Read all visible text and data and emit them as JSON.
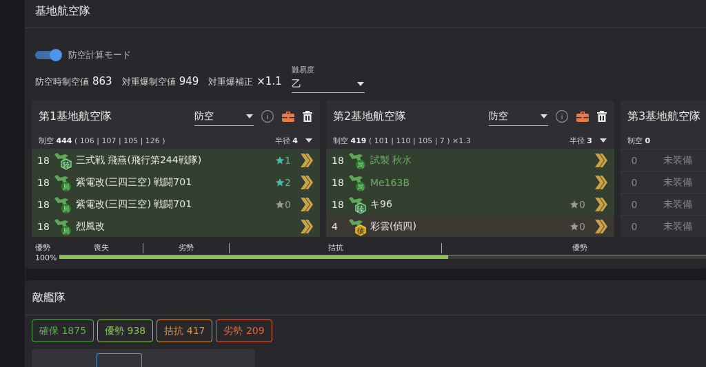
{
  "section_title": "基地航空隊",
  "mode_toggle": {
    "label": "防空計算モード",
    "on": true
  },
  "stats": [
    {
      "label": "防空時制空値",
      "value": "863"
    },
    {
      "label": "対重爆制空値",
      "value": "949"
    },
    {
      "label": "対重爆補正",
      "value": "×1.1"
    }
  ],
  "difficulty": {
    "label": "難易度",
    "value": "乙"
  },
  "bases": [
    {
      "title": "第1基地航空隊",
      "mode": "防空",
      "air_label": "制空",
      "air_value": "444",
      "air_detail": "( 106 | 107 | 105 | 126 )",
      "radius_label": "半径",
      "radius_value": "4",
      "slots": [
        {
          "count": "18",
          "kind": "army",
          "badge": "陸",
          "name": "三式戦 飛燕(飛行第244戦隊)",
          "color": "#e6e6e6",
          "stars": "1",
          "lit": true
        },
        {
          "count": "18",
          "kind": "local",
          "badge": "局",
          "name": "紫電改(三四三空) 戦闘701",
          "color": "#e6e6e6",
          "stars": "2",
          "lit": true
        },
        {
          "count": "18",
          "kind": "local",
          "badge": "局",
          "name": "紫電改(三四三空) 戦闘701",
          "color": "#e6e6e6",
          "stars": "0",
          "lit": false
        },
        {
          "count": "18",
          "kind": "local",
          "badge": "局",
          "name": "烈風改",
          "color": "#e6e6e6"
        }
      ]
    },
    {
      "title": "第2基地航空隊",
      "mode": "防空",
      "air_label": "制空",
      "air_value": "419",
      "air_detail": "( 101 | 110 | 105 | 7 ) ×1.3",
      "radius_label": "半径",
      "radius_value": "3",
      "slots": [
        {
          "count": "18",
          "kind": "local",
          "badge": "局",
          "name": "試製 秋水",
          "color": "#6fa866"
        },
        {
          "count": "18",
          "kind": "local",
          "badge": "局",
          "name": "Me163B",
          "color": "#6fa866"
        },
        {
          "count": "18",
          "kind": "army",
          "badge": "陸",
          "name": "キ96",
          "color": "#e6e6e6",
          "stars": "0",
          "lit": false
        },
        {
          "count": "4",
          "kind": "recon",
          "badge": "偵",
          "name": "彩雲(偵四)",
          "color": "#e6e6e6",
          "stars": "0",
          "lit": false
        }
      ]
    },
    {
      "title": "第3基地航空隊",
      "air_label": "制空",
      "air_value": "0",
      "slots": [
        {
          "count": "0",
          "kind": "empty",
          "name": "未装備"
        },
        {
          "count": "0",
          "kind": "empty",
          "name": "未装備"
        },
        {
          "count": "0",
          "kind": "empty",
          "name": "未装備"
        },
        {
          "count": "0",
          "kind": "empty",
          "name": "未装備"
        }
      ]
    }
  ],
  "air_state_bar": {
    "state": "優勢",
    "percent": "100%",
    "level": 0.59,
    "zones": [
      "喪失",
      "劣勢",
      "拮抗",
      "優勢"
    ]
  },
  "enemy_section": {
    "title": "敵艦隊",
    "thresholds": [
      {
        "label": "確保",
        "value": "1875",
        "color": "#5fae55"
      },
      {
        "label": "優勢",
        "value": "938",
        "color": "#8fc35a"
      },
      {
        "label": "拮抗",
        "value": "417",
        "color": "#e0913a"
      },
      {
        "label": "劣勢",
        "value": "209",
        "color": "#e8633a"
      }
    ]
  }
}
